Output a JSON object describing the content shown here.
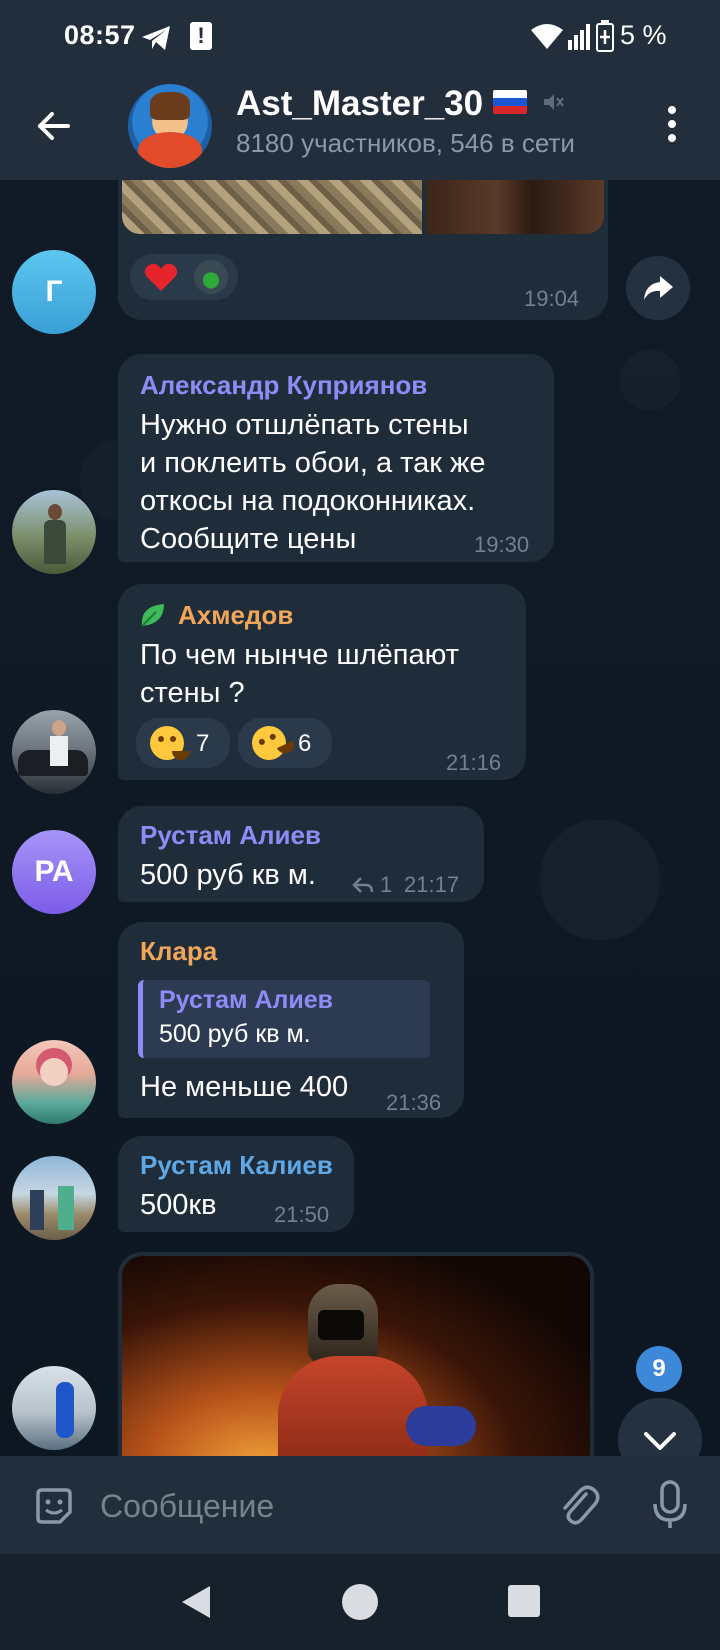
{
  "status_bar": {
    "time": "08:57",
    "battery": "5 %"
  },
  "header": {
    "title": "Ast_Master_30",
    "subtitle": "8180 участников, 546 в сети"
  },
  "messages": [
    {
      "id": "m1",
      "avatar_letter": "Г",
      "time": "19:04",
      "reactions": [
        {
          "emoji": "heart"
        },
        {
          "emoji": "avatar-reaction"
        }
      ]
    },
    {
      "id": "m2",
      "name": "Александр Куприянов",
      "name_color": "#8d8cf6",
      "lines": [
        "Нужно отшлёпать стены",
        "и поклеить обои, а так же",
        "откосы на подоконниках.",
        "Сообщите цены"
      ],
      "time": "19:30"
    },
    {
      "id": "m3",
      "name": "Ахмедов",
      "name_color": "#f2a65a",
      "lines": [
        "По чем нынче шлёпают",
        "стены ?"
      ],
      "time": "21:16",
      "reactions": [
        {
          "emoji": "grinning-face",
          "count": "7"
        },
        {
          "emoji": "rolling-laughing-face",
          "count": "6"
        }
      ]
    },
    {
      "id": "m4",
      "avatar_letter": "РА",
      "name": "Рустам Алиев",
      "name_color": "#8d8cf6",
      "lines": [
        "500 руб кв м."
      ],
      "reply_count": "1",
      "time": "21:17"
    },
    {
      "id": "m5",
      "name": "Клара",
      "name_color": "#f2a65a",
      "quote": {
        "name": "Рустам Алиев",
        "text": "500 руб кв м."
      },
      "lines": [
        "Не меньше 400"
      ],
      "time": "21:36"
    },
    {
      "id": "m6",
      "name": "Рустам Калиев",
      "name_color": "#5fa8e6",
      "lines": [
        "500кв"
      ],
      "time": "21:50"
    }
  ],
  "unread_badge": "9",
  "composer": {
    "placeholder": "Сообщение"
  },
  "colors": {
    "background": "#0e1621",
    "bubble": "#1f2c3a",
    "header": "#232e3c",
    "accent": "#3e88d9"
  }
}
